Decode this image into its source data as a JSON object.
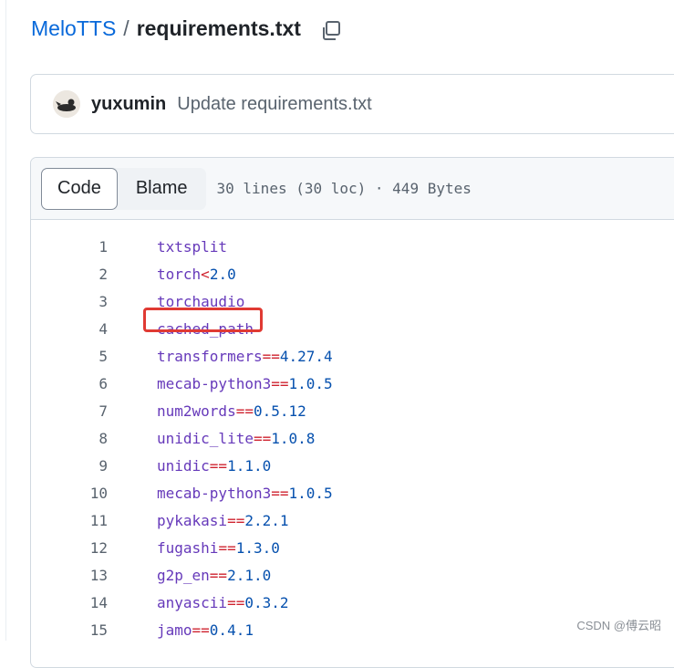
{
  "breadcrumb": {
    "repo": "MeloTTS",
    "separator": "/",
    "file": "requirements.txt"
  },
  "commit": {
    "author": "yuxumin",
    "message": "Update requirements.txt"
  },
  "file_header": {
    "tabs": [
      "Code",
      "Blame"
    ],
    "active_tab": "Code",
    "meta": "30 lines (30 loc) · 449 Bytes"
  },
  "code_lines": [
    {
      "num": "1",
      "name": "txtsplit",
      "op": "",
      "ver": ""
    },
    {
      "num": "2",
      "name": "torch",
      "op": "<",
      "ver": "2.0"
    },
    {
      "num": "3",
      "name": "torchaudio",
      "op": "",
      "ver": ""
    },
    {
      "num": "4",
      "name": "cached_path",
      "op": "",
      "ver": ""
    },
    {
      "num": "5",
      "name": "transformers",
      "op": "==",
      "ver": "4.27.4"
    },
    {
      "num": "6",
      "name": "mecab-python3",
      "op": "==",
      "ver": "1.0.5"
    },
    {
      "num": "7",
      "name": "num2words",
      "op": "==",
      "ver": "0.5.12"
    },
    {
      "num": "8",
      "name": "unidic_lite",
      "op": "==",
      "ver": "1.0.8"
    },
    {
      "num": "9",
      "name": "unidic",
      "op": "==",
      "ver": "1.1.0"
    },
    {
      "num": "10",
      "name": "mecab-python3",
      "op": "==",
      "ver": "1.0.5"
    },
    {
      "num": "11",
      "name": "pykakasi",
      "op": "==",
      "ver": "2.2.1"
    },
    {
      "num": "12",
      "name": "fugashi",
      "op": "==",
      "ver": "1.3.0"
    },
    {
      "num": "13",
      "name": "g2p_en",
      "op": "==",
      "ver": "2.1.0"
    },
    {
      "num": "14",
      "name": "anyascii",
      "op": "==",
      "ver": "0.3.2"
    },
    {
      "num": "15",
      "name": "jamo",
      "op": "==",
      "ver": "0.4.1"
    }
  ],
  "highlighted_line": "2",
  "watermark": "CSDN @傅云昭",
  "colors": {
    "link": "#0969da",
    "highlight": "#e03a33",
    "package": "#6639ba",
    "operator": "#cf222e",
    "version": "#0550ae"
  },
  "icons": {
    "copy": "copy-path-icon",
    "avatar": "user-avatar"
  }
}
